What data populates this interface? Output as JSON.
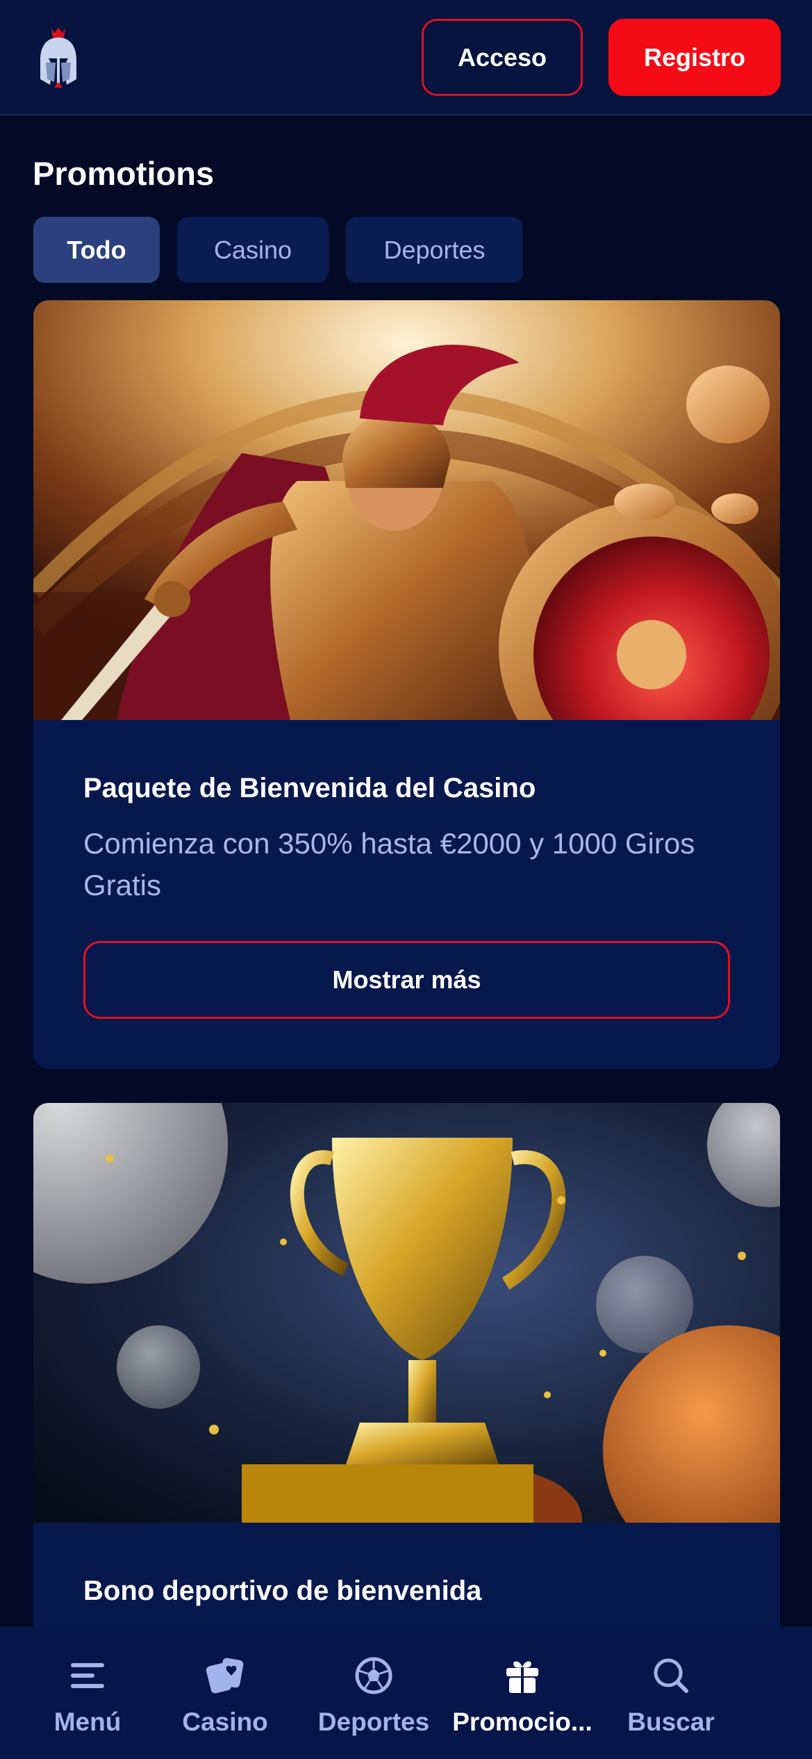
{
  "header": {
    "logo_icon": "spartan-helmet-logo",
    "login_label": "Acceso",
    "register_label": "Registro"
  },
  "page": {
    "title": "Promotions"
  },
  "tabs": [
    {
      "label": "Todo",
      "active": true
    },
    {
      "label": "Casino",
      "active": false
    },
    {
      "label": "Deportes",
      "active": false
    }
  ],
  "promos": [
    {
      "image": "gladiator-warrior-illustration",
      "title": "Paquete de Bienvenida del Casino",
      "description": "Comienza con 350% hasta €2000 y 1000 Giros Gratis",
      "button_label": "Mostrar más"
    },
    {
      "image": "golden-trophy-illustration",
      "title": "Bono deportivo de bienvenida"
    }
  ],
  "bottom_nav": [
    {
      "label": "Menú",
      "icon": "menu-icon",
      "active": false
    },
    {
      "label": "Casino",
      "icon": "casino-cards-icon",
      "active": false
    },
    {
      "label": "Deportes",
      "icon": "soccer-ball-icon",
      "active": false
    },
    {
      "label": "Promocio...",
      "icon": "gift-icon",
      "active": true
    },
    {
      "label": "Buscar",
      "icon": "search-icon",
      "active": false
    }
  ],
  "colors": {
    "background": "#020a26",
    "header": "#06143f",
    "card": "#07184d",
    "accent_red": "#f50b16",
    "muted_text": "#aab6ee"
  }
}
